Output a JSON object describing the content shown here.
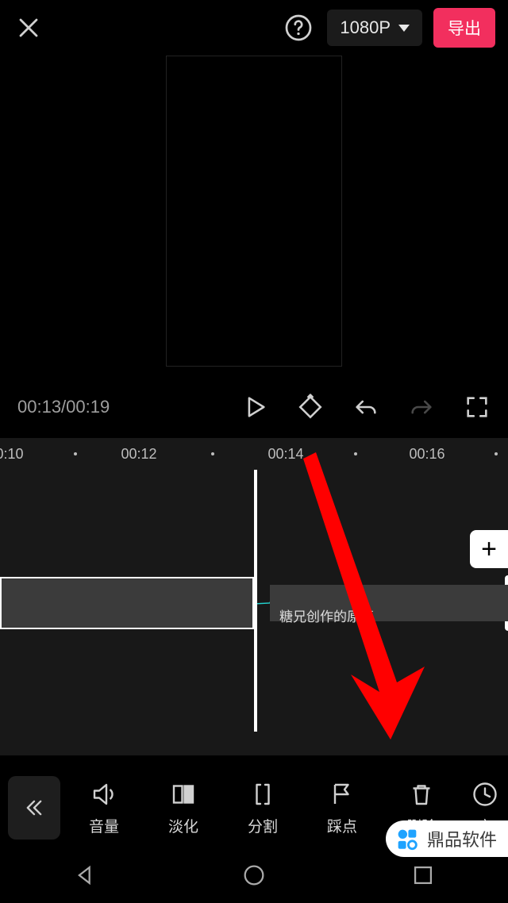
{
  "header": {
    "resolution": "1080P",
    "export": "导出"
  },
  "transport": {
    "time": "00:13/00:19"
  },
  "ruler": {
    "labels": [
      "0:10",
      "00:12",
      "00:14",
      "00:16"
    ]
  },
  "clip": {
    "label": "糖兄创作的原声"
  },
  "tools": {
    "volume": "音量",
    "fade": "淡化",
    "split": "分割",
    "beat": "踩点",
    "delete": "删除",
    "speed": "变"
  },
  "watermark": {
    "text": "鼎品软件"
  }
}
